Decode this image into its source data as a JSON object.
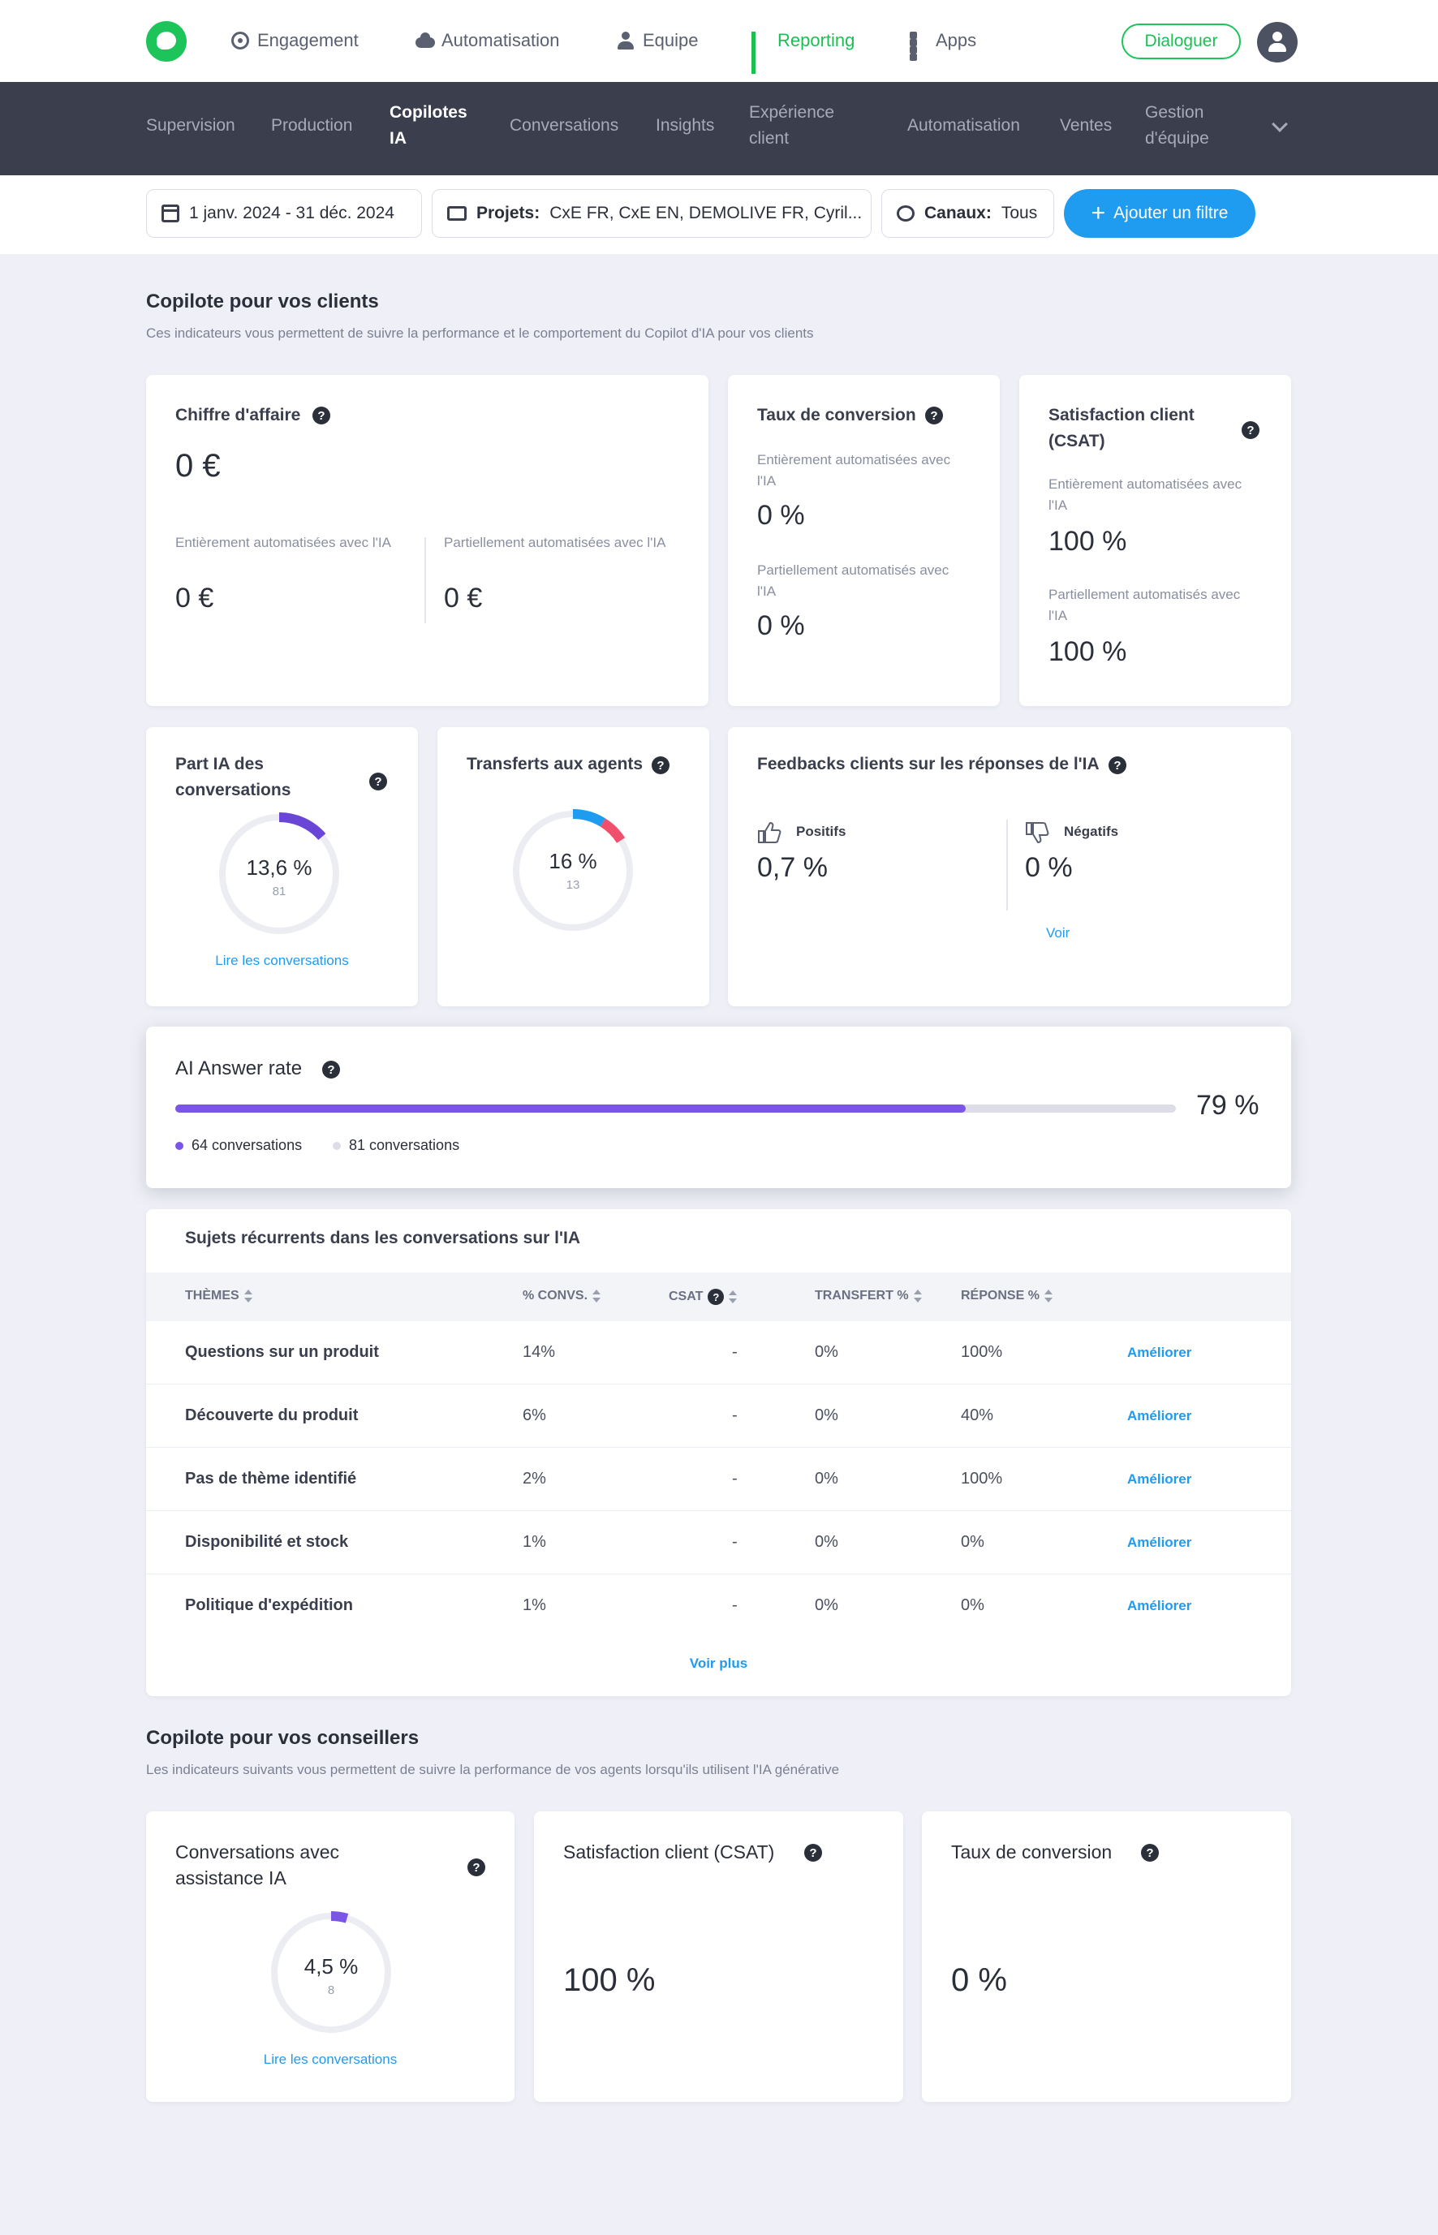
{
  "topnav": {
    "items": [
      {
        "label": "Engagement",
        "icon": "target-icon"
      },
      {
        "label": "Automatisation",
        "icon": "cloud-icon"
      },
      {
        "label": "Equipe",
        "icon": "user-icon"
      },
      {
        "label": "Reporting",
        "icon": "bar-chart-icon",
        "active": true
      },
      {
        "label": "Apps",
        "icon": "grid-icon"
      }
    ],
    "dialog_button": "Dialoguer",
    "accent": "#1cc45a"
  },
  "subnav": {
    "items": [
      {
        "label": "Supervision"
      },
      {
        "label": "Production"
      },
      {
        "label": "Copilotes IA",
        "active": true
      },
      {
        "label": "Conversations"
      },
      {
        "label": "Insights"
      },
      {
        "label": "Expérience client"
      },
      {
        "label": "Automatisation"
      },
      {
        "label": "Ventes"
      },
      {
        "label": "Gestion d'équipe"
      }
    ]
  },
  "filters": {
    "date": "1 janv. 2024 - 31 déc. 2024",
    "projects_label": "Projets:",
    "projects_value": "CxE FR, CxE EN, DEMOLIVE FR, Cyril...",
    "channels_label": "Canaux:",
    "channels_value": "Tous",
    "add_filter": "Ajouter un filtre"
  },
  "clients": {
    "title": "Copilote pour vos clients",
    "desc": "Ces indicateurs vous permettent de suivre la performance et le comportement du Copilot d'IA pour vos clients",
    "revenue": {
      "title": "Chiffre d'affaire",
      "value": "0 €",
      "full_label": "Entièrement automatisées avec l'IA",
      "full_value": "0 €",
      "partial_label": "Partiellement automatisées avec l'IA",
      "partial_value": "0 €"
    },
    "conversion": {
      "title": "Taux de conversion",
      "full_label": "Entièrement automatisées avec l'IA",
      "full_value": "0 %",
      "partial_label": "Partiellement automatisés avec l'IA",
      "partial_value": "0 %"
    },
    "csat": {
      "title": "Satisfaction client (CSAT)",
      "full_label": "Entièrement automatisées avec l'IA",
      "full_value": "100 %",
      "partial_label": "Partiellement automatisés avec l'IA",
      "partial_value": "100 %"
    },
    "ai_share": {
      "title": "Part IA des conversations",
      "percent": "13,6 %",
      "count": "81",
      "fraction": 0.136,
      "link": "Lire les conversations"
    },
    "transfers": {
      "title": "Transferts aux agents",
      "percent": "16 %",
      "count": "13",
      "fraction": 0.16
    },
    "feedbacks": {
      "title": "Feedbacks clients sur les réponses de l'IA",
      "positive_label": "Positifs",
      "positive_value": "0,7 %",
      "negative_label": "Négatifs",
      "negative_value": "0 %",
      "link": "Voir"
    },
    "answer_rate": {
      "title": "AI Answer rate",
      "value": "79 %",
      "fraction": 0.79,
      "legend_answered": "64 conversations",
      "legend_total": "81 conversations",
      "color": "#7b55e6"
    },
    "topics": {
      "title": "Sujets récurrents dans les conversations sur l'IA",
      "headers": [
        "THÈMES",
        "% CONVS.",
        "CSAT",
        "TRANSFERT %",
        "RÉPONSE %"
      ],
      "rows": [
        {
          "theme": "Questions sur un produit",
          "convs": "14%",
          "csat": "-",
          "transfer": "0%",
          "answer": "100%",
          "action": "Améliorer"
        },
        {
          "theme": "Découverte du produit",
          "convs": "6%",
          "csat": "-",
          "transfer": "0%",
          "answer": "40%",
          "action": "Améliorer"
        },
        {
          "theme": "Pas de thème identifié",
          "convs": "2%",
          "csat": "-",
          "transfer": "0%",
          "answer": "100%",
          "action": "Améliorer"
        },
        {
          "theme": "Disponibilité et stock",
          "convs": "1%",
          "csat": "-",
          "transfer": "0%",
          "answer": "0%",
          "action": "Améliorer"
        },
        {
          "theme": "Politique d'expédition",
          "convs": "1%",
          "csat": "-",
          "transfer": "0%",
          "answer": "0%",
          "action": "Améliorer"
        }
      ],
      "more": "Voir plus"
    }
  },
  "advisors": {
    "title": "Copilote pour vos conseillers",
    "desc": "Les indicateurs suivants vous permettent de suivre la performance de vos agents lorsqu'ils utilisent l'IA générative",
    "assisted": {
      "title": "Conversations avec assistance IA",
      "percent": "4,5 %",
      "count": "8",
      "fraction": 0.045,
      "link": "Lire les conversations"
    },
    "csat": {
      "title": "Satisfaction client (CSAT)",
      "value": "100 %"
    },
    "conversion": {
      "title": "Taux de conversion",
      "value": "0 %"
    }
  }
}
